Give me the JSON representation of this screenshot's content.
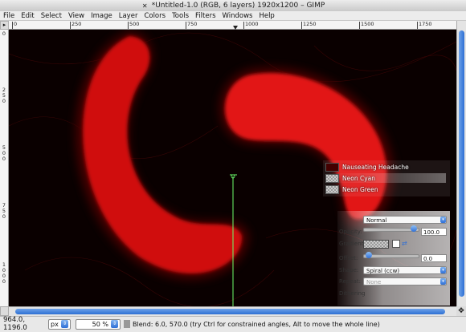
{
  "window": {
    "title": "*Untitled-1.0 (RGB, 6 layers) 1920x1200 – GIMP"
  },
  "menu": [
    "File",
    "Edit",
    "Select",
    "View",
    "Image",
    "Layer",
    "Colors",
    "Tools",
    "Filters",
    "Windows",
    "Help"
  ],
  "ruler": {
    "horizontal": [
      "0",
      "250",
      "500",
      "750",
      "1000",
      "1250",
      "1500",
      "1750"
    ],
    "vertical": [
      "0",
      "250",
      "500",
      "750",
      "1000"
    ]
  },
  "layers": [
    {
      "name": "Nauseating Headache",
      "selected": false
    },
    {
      "name": "Neon Cyan",
      "selected": true
    },
    {
      "name": "Neon Green",
      "selected": false
    }
  ],
  "tool_options": {
    "mode_label": "",
    "mode_value": "Normal",
    "opacity_label": "Opacity:",
    "opacity_value": "100.0",
    "gradient_label": "Gradient:",
    "offset_label": "Offset:",
    "offset_value": "0.0",
    "shape_label": "Shape:",
    "shape_value": "Spiral (ccw)",
    "repeat_label": "Repeat:",
    "repeat_value": "None",
    "dithering_label": "Dithering"
  },
  "status": {
    "coords": "964.0, 1196.0",
    "unit": "px",
    "zoom": "50 %",
    "message": "Blend: 6.0, 570.0 (try Ctrl for constrained angles, Alt to move the whole line)"
  },
  "colors": {
    "canvas_bg": "#0a0000",
    "spiral": "#e01010",
    "accent": "#2f6fd6",
    "guide_line": "#6dff6d"
  }
}
